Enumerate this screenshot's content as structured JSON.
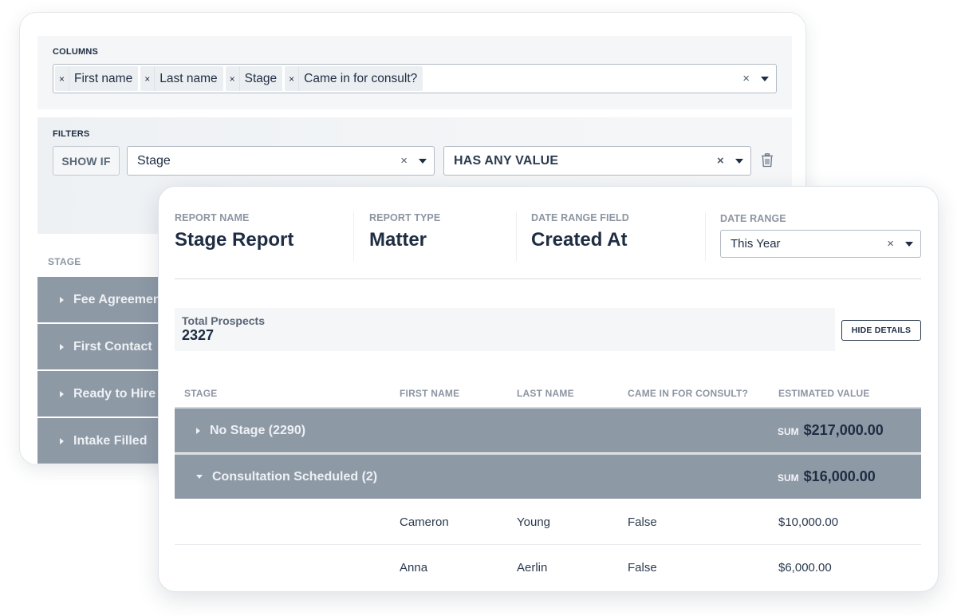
{
  "builder": {
    "columns": {
      "label": "COLUMNS",
      "chips": [
        {
          "label": "First name"
        },
        {
          "label": "Last name"
        },
        {
          "label": "Stage"
        },
        {
          "label": "Came in for consult?"
        }
      ],
      "chip_remove_glyph": "×",
      "clear_glyph": "×"
    },
    "filters": {
      "label": "FILTERS",
      "show_if_label": "SHOW IF",
      "field_value": "Stage",
      "condition_value": "HAS ANY VALUE",
      "clear_glyph": "×"
    },
    "stage_header": "STAGE",
    "stage_rows": [
      {
        "label": "Fee Agreement Sent"
      },
      {
        "label": "First Contact"
      },
      {
        "label": "Ready to Hire"
      },
      {
        "label": "Intake Filled"
      }
    ]
  },
  "report": {
    "meta": {
      "name_label": "REPORT NAME",
      "name_value": "Stage Report",
      "type_label": "REPORT TYPE",
      "type_value": "Matter",
      "field_label": "DATE RANGE FIELD",
      "field_value": "Created At",
      "range_label": "DATE RANGE",
      "range_value": "This Year",
      "clear_glyph": "×"
    },
    "totals": {
      "label": "Total Prospects",
      "value": "2327"
    },
    "hide_details_label": "HIDE DETAILS",
    "table": {
      "headers": [
        "STAGE",
        "FIRST NAME",
        "LAST NAME",
        "CAME IN FOR CONSULT?",
        "ESTIMATED VALUE"
      ],
      "groups": [
        {
          "label": "No Stage (2290)",
          "expanded": false,
          "sum_label": "SUM",
          "sum_value": "$217,000.00"
        },
        {
          "label": "Consultation Scheduled (2)",
          "expanded": true,
          "sum_label": "SUM",
          "sum_value": "$16,000.00"
        }
      ],
      "rows": [
        {
          "first_name": "Cameron",
          "last_name": "Young",
          "came_in": "False",
          "value": "$10,000.00"
        },
        {
          "first_name": "Anna",
          "last_name": "Aerlin",
          "came_in": "False",
          "value": "$6,000.00"
        }
      ]
    }
  },
  "colors": {
    "text_primary": "#1e2d42",
    "text_muted": "#8c95a2",
    "group_row_bg": "#8e99a6",
    "panel_bg": "#f4f6f8"
  }
}
